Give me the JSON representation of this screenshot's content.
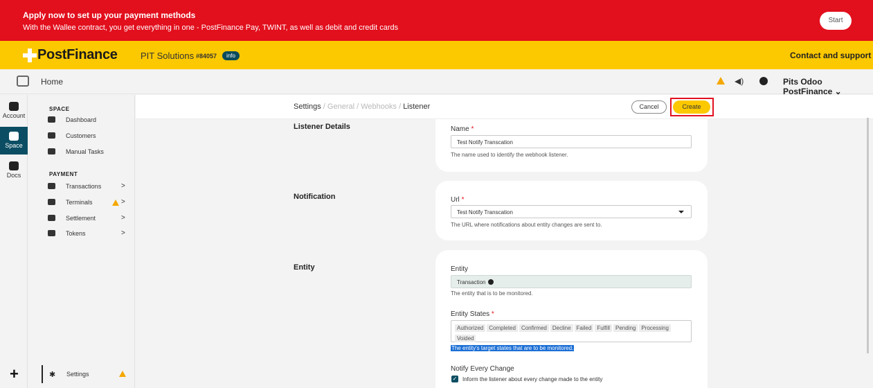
{
  "banner": {
    "title": "Apply now to set up your payment methods",
    "text": "With the Wallee contract, you get everything in one - PostFinance Pay, TWINT, as well as debit and credit cards",
    "start_label": "Start"
  },
  "brand": {
    "name": "PostFinance",
    "space_name": "PIT Solutions",
    "space_id": "#84057",
    "info_label": "info",
    "contact_label": "Contact and support"
  },
  "topnav": {
    "home_label": "Home",
    "account_name": "Pits Odoo PostFinance ⌄"
  },
  "rail": {
    "items": [
      {
        "label": "Account",
        "icon": "account-icon"
      },
      {
        "label": "Space",
        "icon": "space-icon"
      },
      {
        "label": "Docs",
        "icon": "docs-icon"
      }
    ]
  },
  "sidebar": {
    "space_section": "SPACE",
    "space_items": [
      {
        "label": "Dashboard",
        "icon": "dashboard-icon"
      },
      {
        "label": "Customers",
        "icon": "customers-icon"
      },
      {
        "label": "Manual Tasks",
        "icon": "megaphone-icon"
      }
    ],
    "payment_section": "PAYMENT",
    "payment_items": [
      {
        "label": "Transactions",
        "icon": "card-icon",
        "chevron": ">"
      },
      {
        "label": "Terminals",
        "icon": "terminal-icon",
        "chevron": ">"
      },
      {
        "label": "Settlement",
        "icon": "transfer-icon",
        "chevron": ">"
      },
      {
        "label": "Tokens",
        "icon": "token-icon",
        "chevron": ">"
      }
    ],
    "settings_label": "Settings"
  },
  "breadcrumb": {
    "settings": "Settings",
    "sep": " / ",
    "general": "General",
    "webhooks": "Webhooks",
    "listener": "Listener"
  },
  "actions": {
    "cancel_label": "Cancel",
    "create_label": "Create"
  },
  "form": {
    "listener_details": {
      "section_title": "Listener Details",
      "name_label": "Name",
      "required_mark": "*",
      "name_value": "Test Notify Transcation",
      "name_help": "The name used to identify the webhook listener."
    },
    "notification": {
      "section_title": "Notification",
      "url_label": "Url",
      "url_value": "Test Notify Transcation",
      "url_help": "The URL where notifications about entity changes are sent to."
    },
    "entity": {
      "section_title": "Entity",
      "entity_label": "Entity",
      "entity_value": "Transaction",
      "entity_help": "The entity that is to be monitored.",
      "states_label": "Entity States",
      "states": [
        "Authorized",
        "Completed",
        "Confirmed",
        "Decline",
        "Failed",
        "Fulfill",
        "Pending",
        "Processing",
        "Voided"
      ],
      "states_help": "The entity's target states that are to be monitored.",
      "notify_label": "Notify Every Change",
      "notify_checkbox_label": "Inform the listener about every change made to the entity",
      "notify_checked": true
    }
  },
  "colors": {
    "banner": "#e20f1d",
    "brand": "#fcc800",
    "accent": "#0b4e63",
    "highlight": "#1c6fd6"
  }
}
